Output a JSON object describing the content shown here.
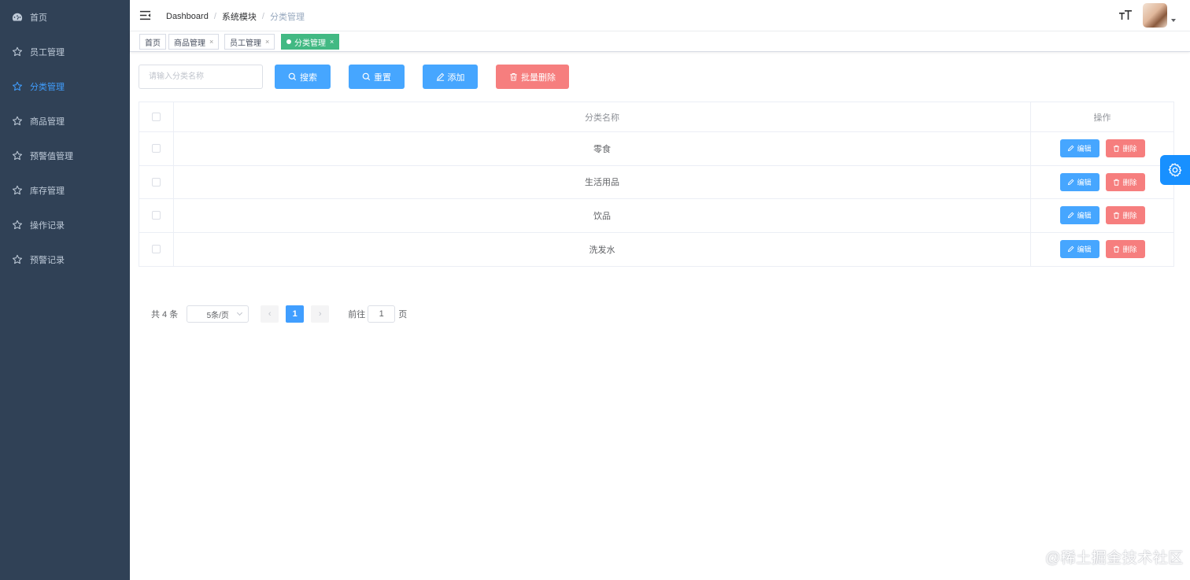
{
  "sidebar": {
    "items": [
      {
        "label": "首页",
        "icon": "dashboard-icon",
        "active": false
      },
      {
        "label": "员工管理",
        "icon": "star-icon",
        "active": false
      },
      {
        "label": "分类管理",
        "icon": "star-icon",
        "active": true
      },
      {
        "label": "商品管理",
        "icon": "star-icon",
        "active": false
      },
      {
        "label": "预警值管理",
        "icon": "star-icon",
        "active": false
      },
      {
        "label": "库存管理",
        "icon": "star-icon",
        "active": false
      },
      {
        "label": "操作记录",
        "icon": "star-icon",
        "active": false
      },
      {
        "label": "预警记录",
        "icon": "star-icon",
        "active": false
      }
    ]
  },
  "header": {
    "breadcrumb": [
      "Dashboard",
      "系统模块",
      "分类管理"
    ],
    "separator": "/"
  },
  "tags": [
    {
      "label": "首页",
      "closable": false,
      "active": false
    },
    {
      "label": "商品管理",
      "closable": true,
      "active": false
    },
    {
      "label": "员工管理",
      "closable": true,
      "active": false
    },
    {
      "label": "分类管理",
      "closable": true,
      "active": true
    }
  ],
  "tag_close": "×",
  "toolbar": {
    "search_placeholder": "请输入分类名称",
    "search_label": "搜索",
    "reset_label": "重置",
    "add_label": "添加",
    "batch_delete_label": "批量删除"
  },
  "table": {
    "headers": {
      "name": "分类名称",
      "ops": "操作"
    },
    "rows": [
      {
        "name": "零食"
      },
      {
        "name": "生活用品"
      },
      {
        "name": "饮品"
      },
      {
        "name": "洗发水"
      }
    ],
    "edit_label": "编辑",
    "delete_label": "删除"
  },
  "pagination": {
    "total_text": "共 4 条",
    "page_size": "5条/页",
    "current_page": "1",
    "prev": "‹",
    "next": "›",
    "jump_prefix": "前往",
    "jump_value": "1",
    "jump_suffix": "页"
  },
  "watermark": "@稀土掘金技术社区",
  "colors": {
    "sidebar_bg": "#304156",
    "sidebar_text": "#bfcbd9",
    "primary": "#46a6ff",
    "danger": "#f67e7e",
    "tag_active": "#42b983",
    "settings": "#1890ff"
  }
}
